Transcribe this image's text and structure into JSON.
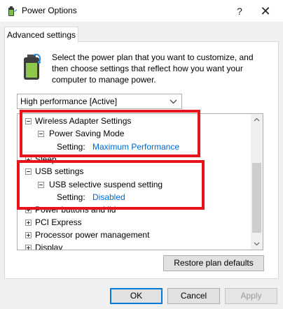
{
  "window": {
    "title": "Power Options",
    "help_label": "?",
    "close_label": "✕"
  },
  "tab": {
    "label": "Advanced settings"
  },
  "intro_text": "Select the power plan that you want to customize, and then choose settings that reflect how you want your computer to manage power.",
  "plan_select": {
    "value": "High performance [Active]"
  },
  "tree": {
    "items": [
      {
        "label": "Wireless Adapter Settings",
        "expanded": true
      },
      {
        "label": "Power Saving Mode",
        "expanded": true
      },
      {
        "setting_label": "Setting:",
        "setting_value": "Maximum Performance"
      },
      {
        "label": "Sleep",
        "expanded": false
      },
      {
        "label": "USB settings",
        "expanded": true
      },
      {
        "label": "USB selective suspend setting",
        "expanded": true
      },
      {
        "setting_label": "Setting:",
        "setting_value": "Disabled"
      },
      {
        "label": "Power buttons and lid",
        "expanded": false
      },
      {
        "label": "PCI Express",
        "expanded": false
      },
      {
        "label": "Processor power management",
        "expanded": false
      },
      {
        "label": "Display",
        "expanded": false
      }
    ]
  },
  "buttons": {
    "restore": "Restore plan defaults",
    "ok": "OK",
    "cancel": "Cancel",
    "apply": "Apply"
  },
  "colors": {
    "highlight_box": "#e8131d",
    "setting_value": "#0066cc"
  },
  "icons": {
    "app": "battery-plug-icon",
    "intro": "battery-icon"
  }
}
